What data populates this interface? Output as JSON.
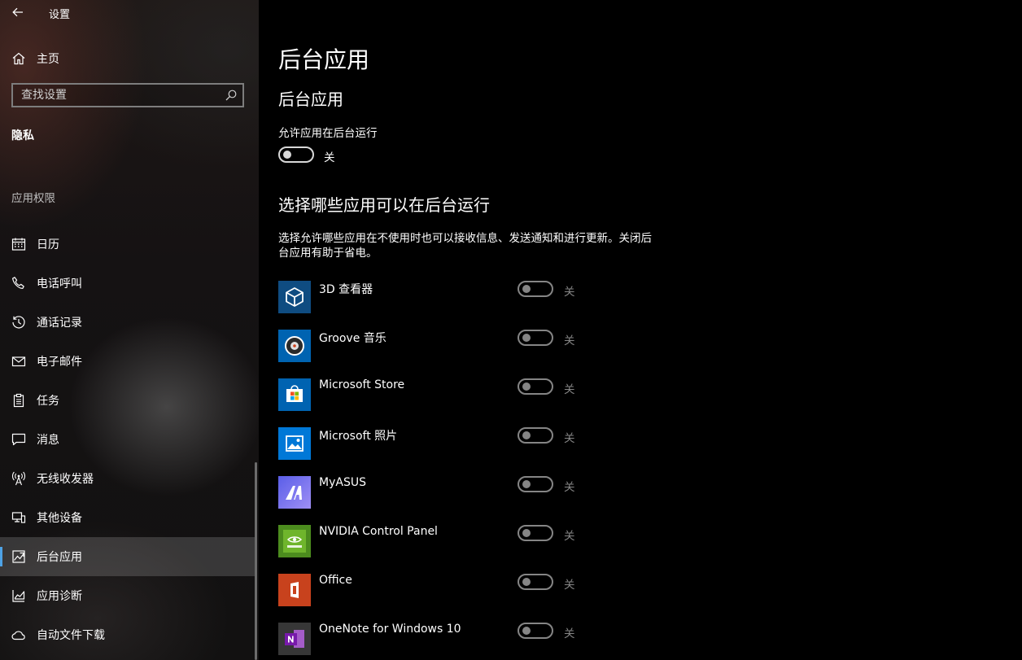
{
  "window": {
    "title": "设置"
  },
  "sidebar": {
    "home": {
      "label": "主页",
      "icon": "home-icon"
    },
    "search": {
      "placeholder": "查找设置"
    },
    "section_title": "隐私",
    "group_header": "应用权限",
    "items": [
      {
        "id": "calendar",
        "label": "日历",
        "icon": "calendar-icon"
      },
      {
        "id": "phone-calls",
        "label": "电话呼叫",
        "icon": "phone-icon"
      },
      {
        "id": "call-history",
        "label": "通话记录",
        "icon": "history-icon"
      },
      {
        "id": "email",
        "label": "电子邮件",
        "icon": "mail-icon"
      },
      {
        "id": "tasks",
        "label": "任务",
        "icon": "clipboard-icon"
      },
      {
        "id": "messages",
        "label": "消息",
        "icon": "chat-icon"
      },
      {
        "id": "radios",
        "label": "无线收发器",
        "icon": "antenna-icon"
      },
      {
        "id": "other-devices",
        "label": "其他设备",
        "icon": "devices-icon"
      },
      {
        "id": "background-apps",
        "label": "后台应用",
        "icon": "background-apps-icon",
        "active": true
      },
      {
        "id": "app-diagnostics",
        "label": "应用诊断",
        "icon": "diagnostics-icon"
      },
      {
        "id": "auto-downloads",
        "label": "自动文件下载",
        "icon": "cloud-icon"
      }
    ]
  },
  "main": {
    "page_title": "后台应用",
    "section1_title": "后台应用",
    "allow_label": "允许应用在后台运行",
    "allow_state": "关",
    "section2_title": "选择哪些应用可以在后台运行",
    "description": "选择允许哪些应用在不使用时也可以接收信息、发送通知和进行更新。关闭后台应用有助于省电。",
    "apps": [
      {
        "name": "3D 查看器",
        "state": "关",
        "icon": "3d-viewer-icon",
        "color": "#0f4c81"
      },
      {
        "name": "Groove 音乐",
        "state": "关",
        "icon": "groove-music-icon",
        "color": "#0063b1"
      },
      {
        "name": "Microsoft Store",
        "state": "关",
        "icon": "store-icon",
        "color": "#0063b1"
      },
      {
        "name": "Microsoft 照片",
        "state": "关",
        "icon": "photos-icon",
        "color": "#0078d7"
      },
      {
        "name": "MyASUS",
        "state": "关",
        "icon": "myasus-icon",
        "color": "#6f6df5"
      },
      {
        "name": "NVIDIA Control Panel",
        "state": "关",
        "icon": "nvidia-icon",
        "color": "#4c8c1e"
      },
      {
        "name": "Office",
        "state": "关",
        "icon": "office-icon",
        "color": "#c8421d"
      },
      {
        "name": "OneNote for Windows 10",
        "state": "关",
        "icon": "onenote-icon",
        "color": "#373737"
      }
    ]
  },
  "colors": {
    "accent": "#4ea3e6",
    "toggle_enabled": "#d8d8d8",
    "toggle_disabled": "#858585"
  }
}
